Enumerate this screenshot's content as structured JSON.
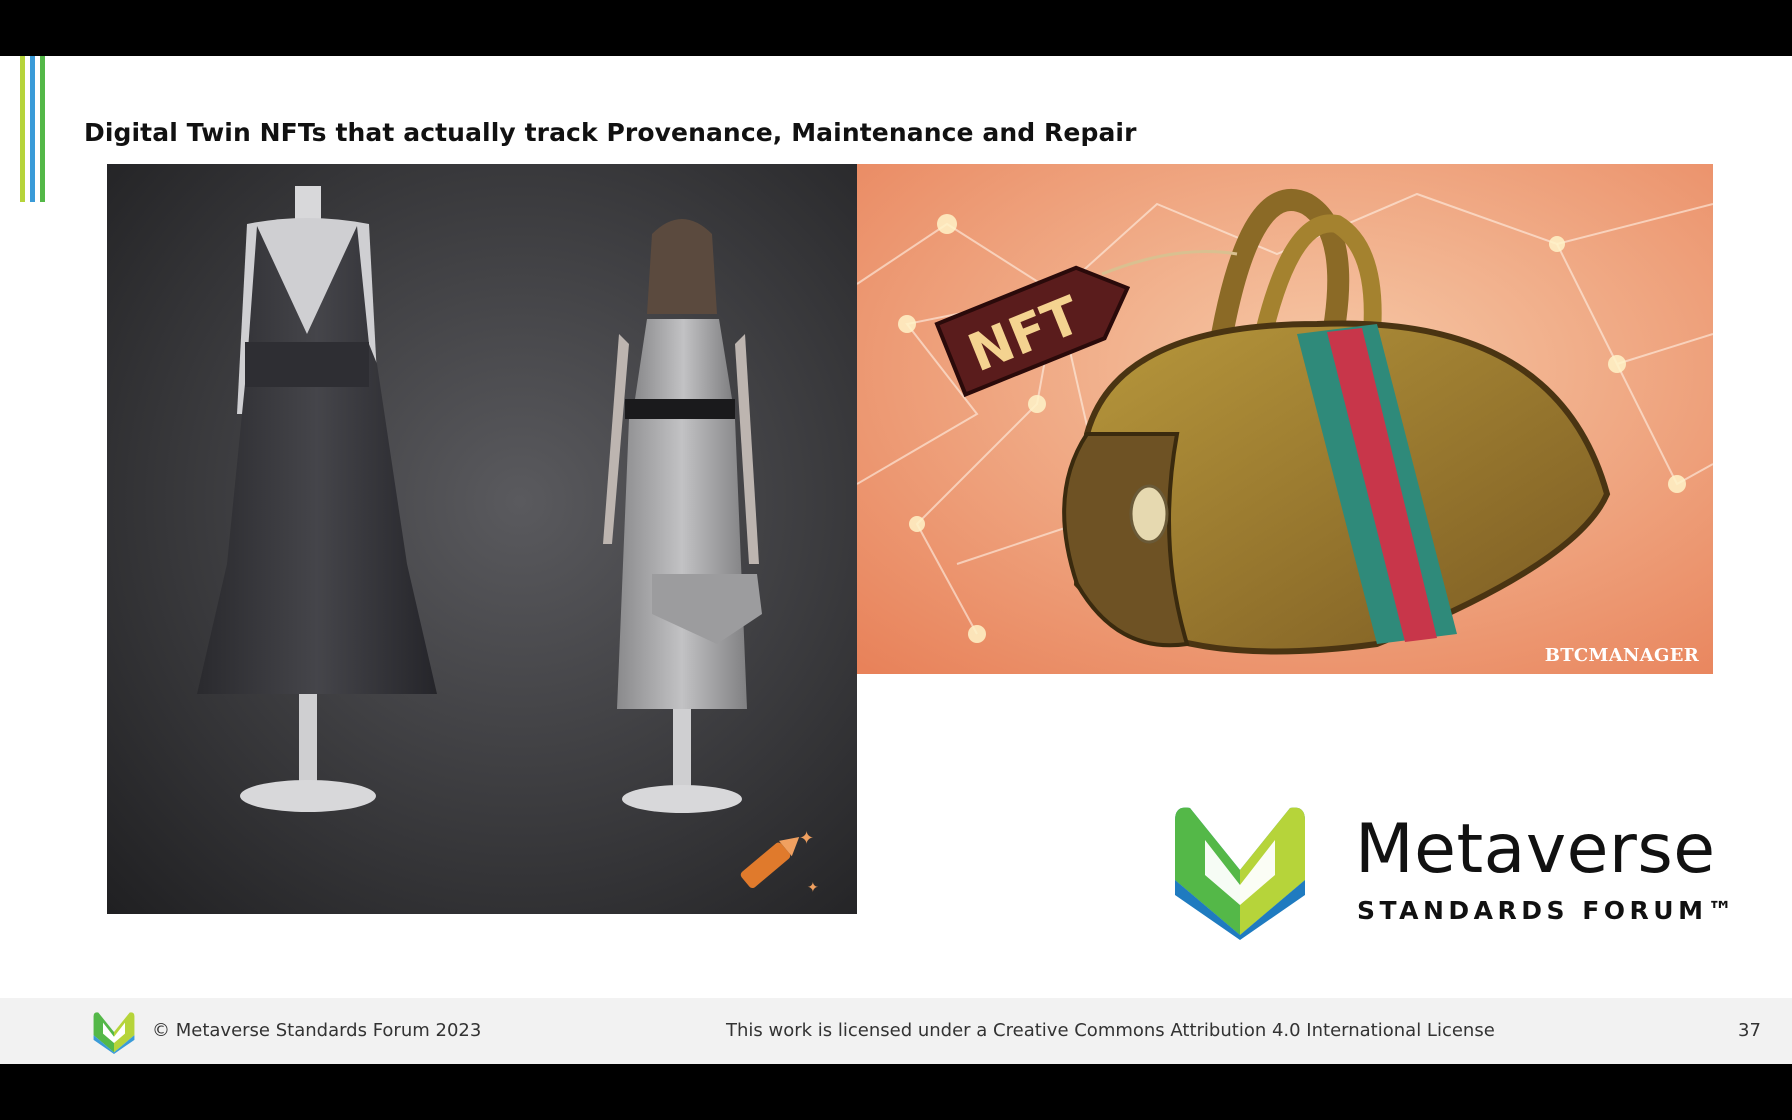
{
  "slide": {
    "title": "Digital Twin NFTs that actually track Provenance, Maintenance and Repair",
    "accent_colors": [
      "#b6d43a",
      "#3a9bd8",
      "#54b848"
    ]
  },
  "images": {
    "left": {
      "description_icon": "mannequin-and-model-photo"
    },
    "right": {
      "tag_text": "NFT",
      "watermark": "BTCMANAGER"
    }
  },
  "brand": {
    "name": "Metaverse",
    "subtitle": "STANDARDS FORUM™"
  },
  "footer": {
    "copyright": "© Metaverse Standards Forum 2023",
    "license": "This work is licensed under a Creative Commons Attribution 4.0 International License",
    "page_number": "37"
  }
}
